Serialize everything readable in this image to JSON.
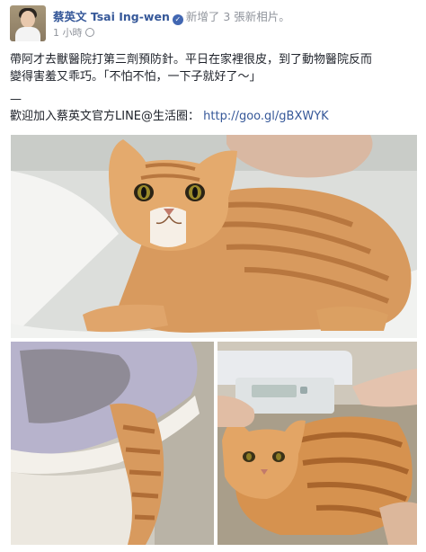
{
  "post": {
    "author": "蔡英文 Tsai Ing-wen",
    "action": "新增了 3 張新相片。",
    "timestamp": "1 小時",
    "text_line1": "帶阿才去獸醫院打第三劑預防針。平日在家裡很皮，到了動物醫院反而",
    "text_line2": "變得害羞又乖巧。「不怕不怕，一下子就好了～」",
    "divider": "—",
    "promo_prefix": "歡迎加入蔡英文官方LINE@生活圈：",
    "promo_link": "http://goo.gl/gBXWYK"
  },
  "icons": {
    "verified": "verified-badge-icon",
    "privacy": "globe-icon"
  },
  "colors": {
    "name_blue": "#365899",
    "meta_gray": "#90949c",
    "text": "#1d2129",
    "verified_badge": "#4267b2"
  }
}
